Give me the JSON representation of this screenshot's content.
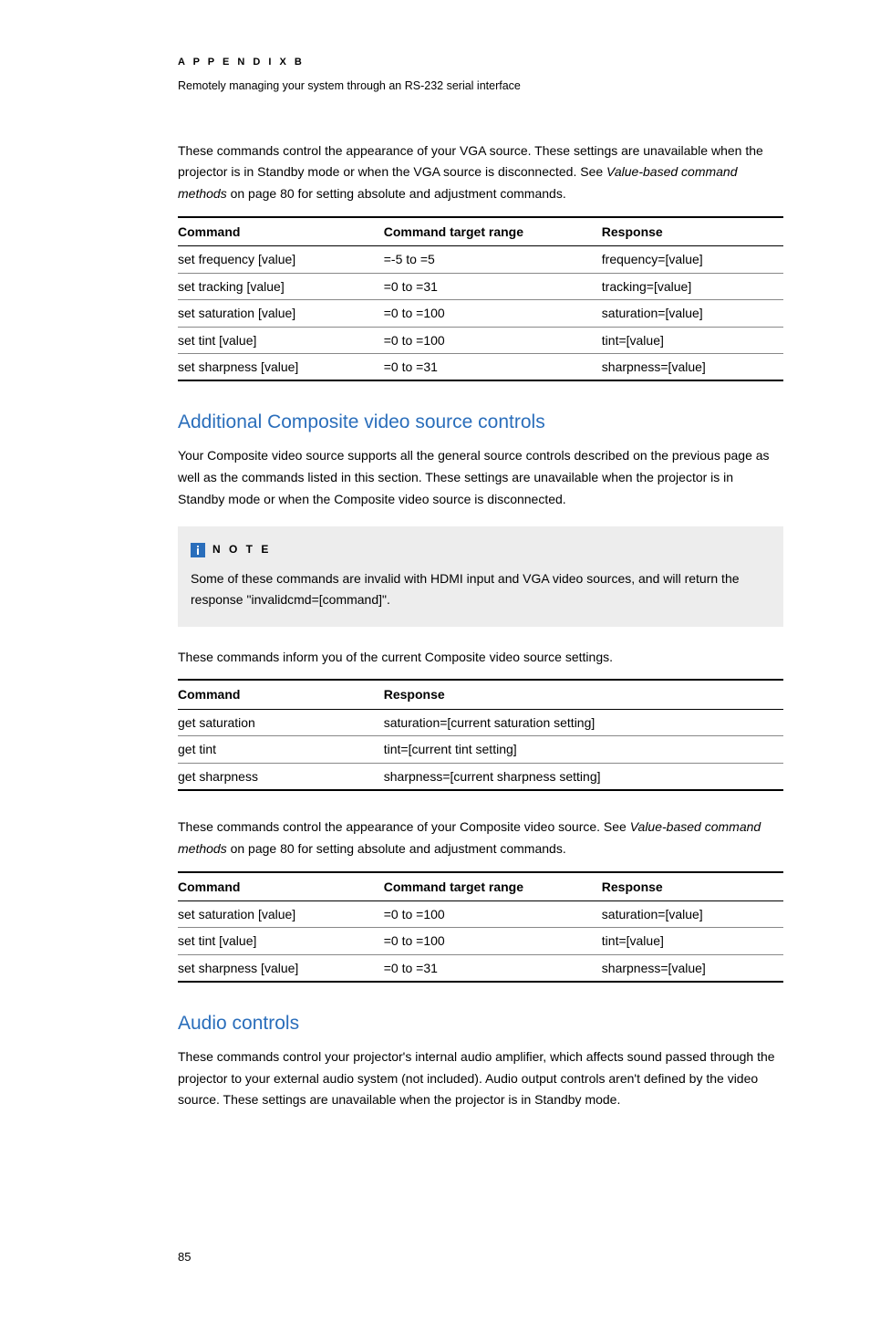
{
  "header": {
    "appendix": "A P P E N D I X   B",
    "subtitle": "Remotely managing your system through an RS-232 serial interface"
  },
  "intro": {
    "p1_a": "These commands control the appearance of your VGA source. These settings are unavailable when the projector is in Standby mode or when the VGA source is disconnected. See ",
    "p1_italic": "Value-based command methods",
    "p1_b": " on page 80 for setting absolute and adjustment commands."
  },
  "table1": {
    "headers": {
      "h1": "Command",
      "h2": "Command target range",
      "h3": "Response"
    },
    "rows": [
      {
        "c1": "set frequency [value]",
        "c2": "=-5 to =5",
        "c3": "frequency=[value]"
      },
      {
        "c1": "set tracking [value]",
        "c2": "=0 to =31",
        "c3": "tracking=[value]"
      },
      {
        "c1": "set saturation [value]",
        "c2": "=0 to =100",
        "c3": "saturation=[value]"
      },
      {
        "c1": "set tint [value]",
        "c2": "=0 to =100",
        "c3": "tint=[value]"
      },
      {
        "c1": "set sharpness [value]",
        "c2": "=0 to =31",
        "c3": "sharpness=[value]"
      }
    ]
  },
  "section1": {
    "title": "Additional Composite video source controls",
    "p1": "Your Composite video source supports all the general source controls described on the previous page as well as the commands listed in this section. These settings are unavailable when the projector is in Standby mode or when the Composite video source is disconnected."
  },
  "note": {
    "label": "N O T E",
    "body": "Some of these commands are invalid with HDMI input and VGA video sources, and will return the response \"invalidcmd=[command]\"."
  },
  "p_after_note": "These commands inform you of the current Composite video source settings.",
  "table2": {
    "headers": {
      "h1": "Command",
      "h2": "Response"
    },
    "rows": [
      {
        "c1": "get saturation",
        "c2": "saturation=[current saturation setting]"
      },
      {
        "c1": "get tint",
        "c2": "tint=[current tint setting]"
      },
      {
        "c1": "get sharpness",
        "c2": "sharpness=[current sharpness setting]"
      }
    ]
  },
  "p_after_t2_a": "These commands control the appearance of your Composite video source. See ",
  "p_after_t2_italic": "Value-based command methods",
  "p_after_t2_b": " on page 80 for setting absolute and adjustment commands.",
  "table3": {
    "headers": {
      "h1": "Command",
      "h2": "Command target range",
      "h3": "Response"
    },
    "rows": [
      {
        "c1": "set saturation [value]",
        "c2": "=0 to =100",
        "c3": "saturation=[value]"
      },
      {
        "c1": "set tint [value]",
        "c2": "=0 to =100",
        "c3": "tint=[value]"
      },
      {
        "c1": "set sharpness [value]",
        "c2": "=0 to =31",
        "c3": "sharpness=[value]"
      }
    ]
  },
  "section2": {
    "title": "Audio controls",
    "p1": "These commands control your projector's internal audio amplifier, which affects sound passed through the projector to your external audio system (not included). Audio output controls aren't defined by the video source. These settings are unavailable when the projector is in Standby mode."
  },
  "page_number": "85"
}
